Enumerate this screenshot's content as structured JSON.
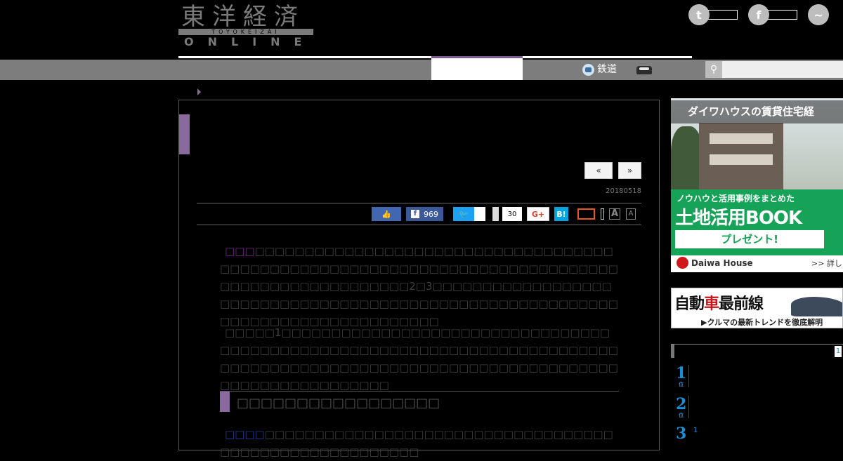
{
  "header": {
    "logo_kanji": "東洋経済",
    "logo_roman": "TOYOKEIZAI",
    "logo_online": "ONLINE",
    "social": [
      {
        "icon": "twitter-icon",
        "glyph": "t"
      },
      {
        "icon": "facebook-icon",
        "glyph": "f"
      },
      {
        "icon": "messenger-icon",
        "glyph": "~"
      }
    ]
  },
  "nav": {
    "items": [
      {
        "label": "鉄道",
        "icon": "train-icon"
      },
      {
        "label": "",
        "icon": "car-icon"
      }
    ],
    "search_icon": "search-icon"
  },
  "article": {
    "prev_label": "«",
    "next_label": "»",
    "date": "20180518",
    "share": {
      "fb_count": "969",
      "hatena_count": "30",
      "gplus_label": "G+",
      "hatena_label": "B!",
      "font_large": "A",
      "font_small": "A"
    },
    "paragraphs": {
      "p1_lead": "□□□",
      "p1_body": "□□□□□□□□□□□□□□□□□□□□□□□□□□□□□□□□□□□□□□□□□□□□□□□□□□□□□□□□□□□□□□□□□□□□□□□□□□□□□□□□□□□□□□□□□□□□□□□2□3□□□□□□□□□□□□□□□□□□□□□□□□□□□□□□□□□□□□□□□□□□□□□□□□□□□□□□□□□□□□□□□□□□□□□□□□□□□□□□□□",
      "p2_body": "□□□□□1□□□□□□□□□□□□□□□□□□□□□□□□□□□□□□□□□□□□□□□□□□□□□□□□□□□□□□□□□□□□□□□□□□□□□□□□□□□□□□□□□□□□□□□□□□□□□□□□□□□□□□□□□□□□□□□□□□□□□□□□□□□□□□□□□□",
      "h2": "□□□□□□□□□□□□□□□□□",
      "p3_lead": "□□□□",
      "p3_body": "□□□□□□□□□□□□□□□□□□□□□□□□□□□□□□□□□□□□□□□□□□□□□□□□□□□□□□□"
    }
  },
  "ads": {
    "ad1": {
      "headline": "ダイワハウスの賃貸住宅経",
      "line1": "ノウハウと活用事例をまとめた",
      "line2": "土地活用BOOK",
      "line3": "プレゼント!",
      "brand": "Daiwa House",
      "more": ">> 詳しく"
    },
    "ad2": {
      "title_a": "自動",
      "title_red": "車",
      "title_b": "最前線",
      "subtitle": "▶クルマの最新トレンドを徹底解明"
    }
  },
  "ranking": {
    "page": "1",
    "items": [
      {
        "rank": "1",
        "suffix": "位"
      },
      {
        "rank": "2",
        "suffix": "位"
      },
      {
        "rank": "3",
        "suffix": "位",
        "sub": "1"
      }
    ]
  }
}
